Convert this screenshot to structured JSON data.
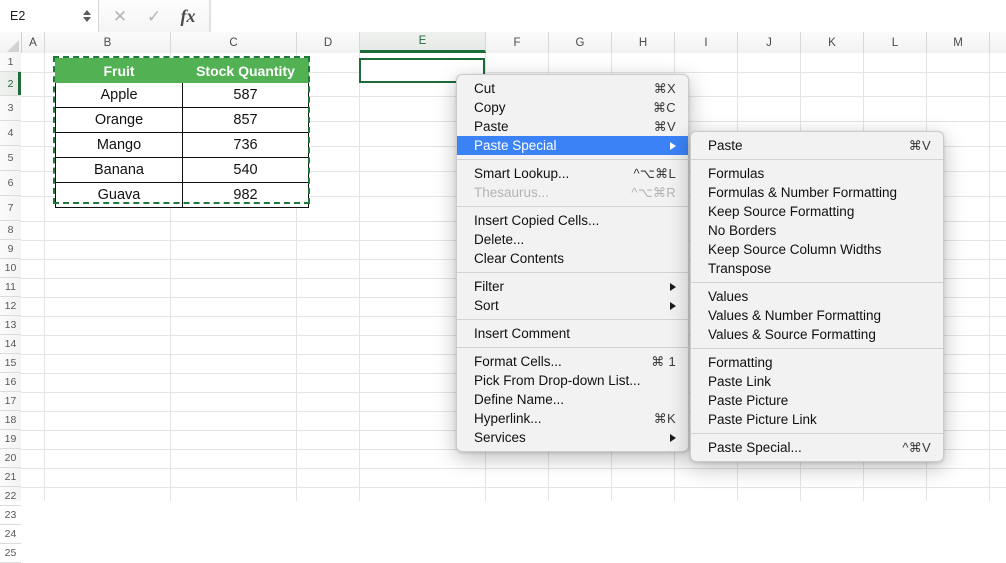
{
  "formula_bar": {
    "name_box_value": "E2",
    "formula_value": "",
    "cancel_icon": "close-icon",
    "confirm_icon": "check-icon",
    "function_icon": "fx-icon"
  },
  "grid": {
    "columns": [
      "A",
      "B",
      "C",
      "D",
      "E",
      "F",
      "G",
      "H",
      "I",
      "J",
      "K",
      "L",
      "M"
    ],
    "active_column": "E",
    "active_row": "2",
    "rows": [
      "1",
      "2",
      "3",
      "4",
      "5",
      "6",
      "7",
      "8",
      "9",
      "10",
      "11",
      "12",
      "13",
      "14",
      "15",
      "16",
      "17",
      "18",
      "19",
      "20",
      "21",
      "22",
      "23",
      "24",
      "25"
    ],
    "selected_cell": "E2",
    "selection_color": "#1d6b38",
    "copy_marquee_color": "#1d7a3a"
  },
  "table": {
    "header_bg": "#52B153",
    "headers": [
      "Fruit",
      "Stock Quantity"
    ],
    "rows": [
      [
        "Apple",
        "587"
      ],
      [
        "Orange",
        "857"
      ],
      [
        "Mango",
        "736"
      ],
      [
        "Banana",
        "540"
      ],
      [
        "Guava",
        "982"
      ]
    ]
  },
  "context_menu": {
    "highlight_color": "#3B82F6",
    "groups": [
      [
        {
          "label": "Cut",
          "shortcut": "⌘X",
          "submenu": false,
          "disabled": false,
          "selected": false
        },
        {
          "label": "Copy",
          "shortcut": "⌘C",
          "submenu": false,
          "disabled": false,
          "selected": false
        },
        {
          "label": "Paste",
          "shortcut": "⌘V",
          "submenu": false,
          "disabled": false,
          "selected": false
        },
        {
          "label": "Paste Special",
          "shortcut": "",
          "submenu": true,
          "disabled": false,
          "selected": true
        }
      ],
      [
        {
          "label": "Smart Lookup...",
          "shortcut": "^⌥⌘L",
          "submenu": false,
          "disabled": false,
          "selected": false
        },
        {
          "label": "Thesaurus...",
          "shortcut": "^⌥⌘R",
          "submenu": false,
          "disabled": true,
          "selected": false
        }
      ],
      [
        {
          "label": "Insert Copied Cells...",
          "shortcut": "",
          "submenu": false,
          "disabled": false,
          "selected": false
        },
        {
          "label": "Delete...",
          "shortcut": "",
          "submenu": false,
          "disabled": false,
          "selected": false
        },
        {
          "label": "Clear Contents",
          "shortcut": "",
          "submenu": false,
          "disabled": false,
          "selected": false
        }
      ],
      [
        {
          "label": "Filter",
          "shortcut": "",
          "submenu": true,
          "disabled": false,
          "selected": false
        },
        {
          "label": "Sort",
          "shortcut": "",
          "submenu": true,
          "disabled": false,
          "selected": false
        }
      ],
      [
        {
          "label": "Insert Comment",
          "shortcut": "",
          "submenu": false,
          "disabled": false,
          "selected": false
        }
      ],
      [
        {
          "label": "Format Cells...",
          "shortcut": "⌘ 1",
          "submenu": false,
          "disabled": false,
          "selected": false
        },
        {
          "label": "Pick From Drop-down List...",
          "shortcut": "",
          "submenu": false,
          "disabled": false,
          "selected": false
        },
        {
          "label": "Define Name...",
          "shortcut": "",
          "submenu": false,
          "disabled": false,
          "selected": false
        },
        {
          "label": "Hyperlink...",
          "shortcut": "⌘K",
          "submenu": false,
          "disabled": false,
          "selected": false
        },
        {
          "label": "Services",
          "shortcut": "",
          "submenu": true,
          "disabled": false,
          "selected": false
        }
      ]
    ]
  },
  "paste_special_submenu": {
    "groups": [
      [
        {
          "label": "Paste",
          "shortcut": "⌘V"
        }
      ],
      [
        {
          "label": "Formulas",
          "shortcut": ""
        },
        {
          "label": "Formulas & Number Formatting",
          "shortcut": ""
        },
        {
          "label": "Keep Source Formatting",
          "shortcut": ""
        },
        {
          "label": "No Borders",
          "shortcut": ""
        },
        {
          "label": "Keep Source Column Widths",
          "shortcut": ""
        },
        {
          "label": "Transpose",
          "shortcut": ""
        }
      ],
      [
        {
          "label": "Values",
          "shortcut": ""
        },
        {
          "label": "Values & Number Formatting",
          "shortcut": ""
        },
        {
          "label": "Values & Source Formatting",
          "shortcut": ""
        }
      ],
      [
        {
          "label": "Formatting",
          "shortcut": ""
        },
        {
          "label": "Paste Link",
          "shortcut": ""
        },
        {
          "label": "Paste Picture",
          "shortcut": ""
        },
        {
          "label": "Paste Picture Link",
          "shortcut": ""
        }
      ],
      [
        {
          "label": "Paste Special...",
          "shortcut": "^⌘V"
        }
      ]
    ]
  }
}
